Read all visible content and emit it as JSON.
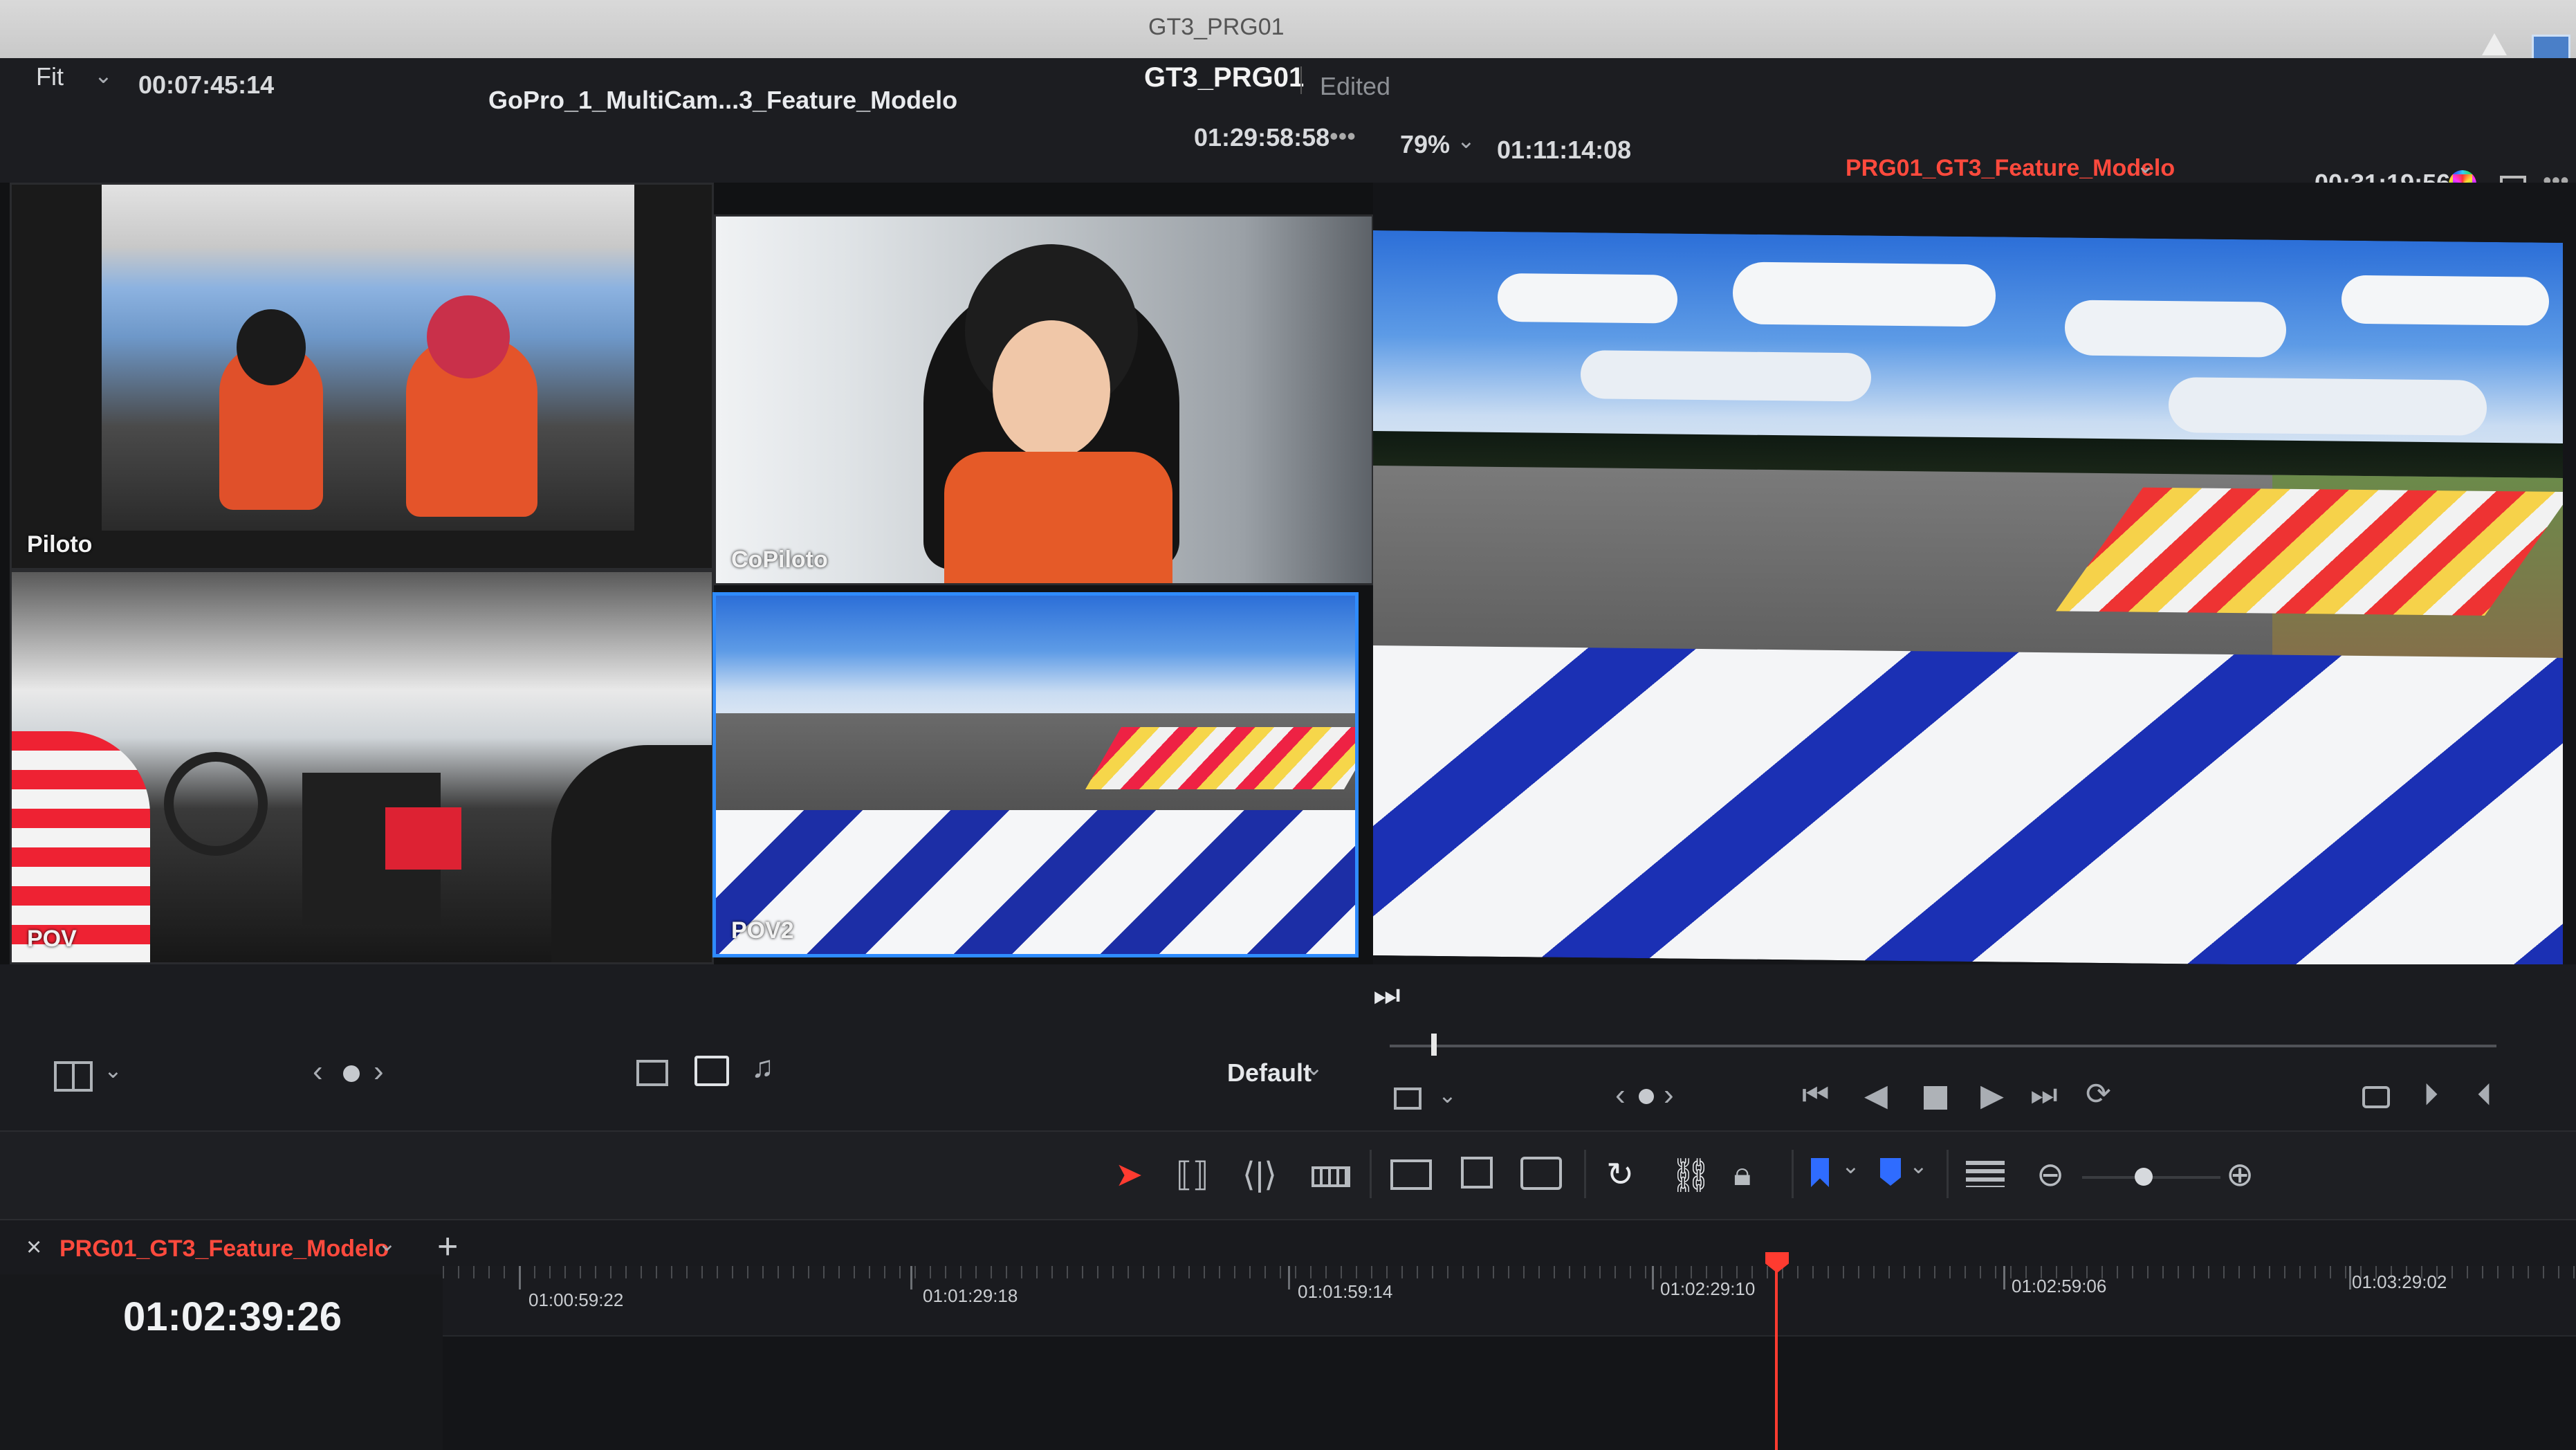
{
  "window": {
    "title": "GT3_PRG01"
  },
  "header": {
    "zoom_left": "Fit",
    "timecode_left": "00:07:45:14",
    "source_clip": "GoPro_1_MultiCam...3_Feature_Modelo",
    "project_title": "GT3_PRG01",
    "project_status": "Edited",
    "timecode_source": "01:29:58:58",
    "more": "•••",
    "zoom_right": "79%",
    "timecode_program": "01:11:14:08",
    "program_timeline": "PRG01_GT3_Feature_Modelo",
    "duration": "00:31:19:56"
  },
  "multicam": {
    "angles": [
      {
        "label": "Piloto"
      },
      {
        "label": "CoPiloto"
      },
      {
        "label": "POV"
      },
      {
        "label": "POV2"
      }
    ]
  },
  "transport_left": {
    "preset": "Default"
  },
  "timeline": {
    "tab_name": "PRG01_GT3_Feature_Modelo",
    "add": "+",
    "close": "×",
    "timecode": "01:02:39:26",
    "ruler": [
      "01:00:59:22",
      "01:01:29:18",
      "01:01:59:14",
      "01:02:29:10",
      "01:02:59:06",
      "01:03:29:02"
    ]
  },
  "colors": {
    "accent_blue": "#2f8cff",
    "playhead_red": "#ff3b30",
    "program_red": "#ff4a3d"
  },
  "icons": [
    "layout-icon",
    "chevron-down-icon",
    "prev-icon",
    "next-icon",
    "dot-icon",
    "film-icon",
    "video-audio-icon",
    "music-icon",
    "play-to-end-icon",
    "crop-icon",
    "jump-start-icon",
    "step-back-icon",
    "stop-icon",
    "play-icon",
    "jump-end-icon",
    "loop-icon",
    "select-arrow-icon",
    "trim-icon",
    "dynamic-trim-icon",
    "blade-icon",
    "insert-icon",
    "overwrite-icon",
    "replace-icon",
    "snap-icon",
    "link-icon",
    "lock-icon",
    "flag-icon",
    "marker-icon",
    "timeline-view-icon",
    "zoom-out-icon",
    "zoom-in-icon"
  ]
}
